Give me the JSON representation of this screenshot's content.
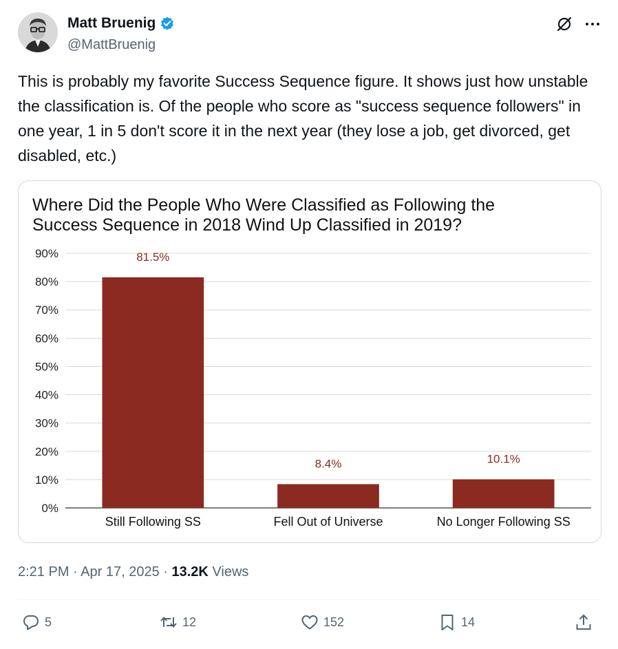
{
  "author": {
    "display_name": "Matt Bruenig",
    "handle": "@MattBruenig",
    "verified": true,
    "verified_color": "#1d9bf0"
  },
  "tweet": {
    "text": "This is probably my favorite Success Sequence figure. It shows just how unstable the classification is. Of the people who score as \"success sequence followers\" in one year, 1 in 5 don't score it in the next year (they lose a job, get divorced, get disabled, etc.)"
  },
  "chart_data": {
    "type": "bar",
    "title": "Where Did the People Who Were Classified as Following the Success Sequence in 2018 Wind Up Classified in 2019?",
    "categories": [
      "Still Following SS",
      "Fell Out of Universe",
      "No Longer Following SS"
    ],
    "values": [
      81.5,
      8.4,
      10.1
    ],
    "data_labels": [
      "81.5%",
      "8.4%",
      "10.1%"
    ],
    "y_ticks": [
      "0%",
      "10%",
      "20%",
      "30%",
      "40%",
      "50%",
      "60%",
      "70%",
      "80%",
      "90%"
    ],
    "ylim": [
      0,
      90
    ],
    "grid": true,
    "bar_color": "#8b2a20",
    "label_color": "#8b2a20",
    "xlabel": "",
    "ylabel": ""
  },
  "meta": {
    "time": "2:21 PM",
    "date": "Apr 17, 2025",
    "views_count": "13.2K",
    "views_label": "Views"
  },
  "actions": {
    "replies": "5",
    "reposts": "12",
    "likes": "152",
    "bookmarks": "14"
  },
  "icons": [
    "verified-badge-icon",
    "grok-icon",
    "more-icon",
    "reply-icon",
    "repost-icon",
    "like-icon",
    "bookmark-icon",
    "share-icon"
  ]
}
